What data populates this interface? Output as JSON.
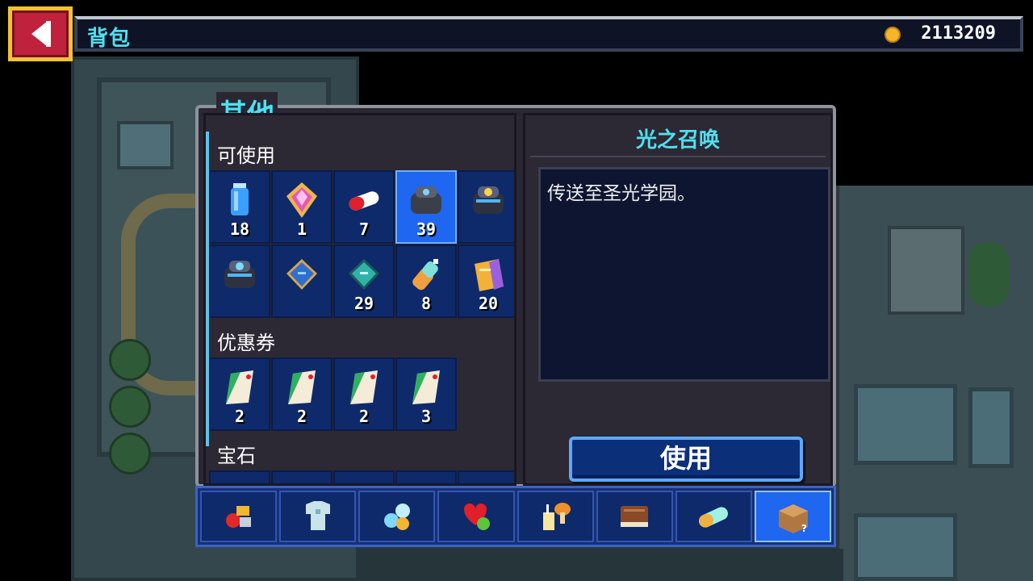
{
  "header": {
    "title": "背包",
    "gold": "2113209",
    "back_icon": "back-arrow-icon",
    "coin_icon": "gold-coin-icon"
  },
  "panel": {
    "category_title": "其他"
  },
  "sections": [
    {
      "label": "可使用",
      "items": [
        {
          "icon": "blue-potion-icon",
          "count": "18"
        },
        {
          "icon": "pink-crystal-icon",
          "count": "1"
        },
        {
          "icon": "red-capsule-icon",
          "count": "7"
        },
        {
          "icon": "dark-portal-device-icon",
          "count": "39",
          "selected": true
        },
        {
          "icon": "gold-portal-device-icon",
          "count": ""
        },
        {
          "icon": "blue-portal-device-icon",
          "count": ""
        },
        {
          "icon": "blue-book-icon",
          "count": ""
        },
        {
          "icon": "teal-book-icon",
          "count": "29"
        },
        {
          "icon": "spray-bottle-icon",
          "count": "8"
        },
        {
          "icon": "gold-ticket-icon",
          "count": "20"
        }
      ]
    },
    {
      "label": "优惠券",
      "items": [
        {
          "icon": "coupon-icon",
          "count": "2"
        },
        {
          "icon": "coupon-icon",
          "count": "2"
        },
        {
          "icon": "coupon-icon",
          "count": "2"
        },
        {
          "icon": "coupon-icon",
          "count": "3"
        }
      ]
    },
    {
      "label": "宝石",
      "items": []
    }
  ],
  "detail": {
    "name": "光之召唤",
    "description": "传送至圣光学园。",
    "use_label": "使用"
  },
  "tabs": [
    {
      "icon": "fruit-materials-icon",
      "active": false
    },
    {
      "icon": "armor-icon",
      "active": false
    },
    {
      "icon": "gems-icon",
      "active": false
    },
    {
      "icon": "heart-apple-icon",
      "active": false
    },
    {
      "icon": "drink-mushroom-icon",
      "active": false
    },
    {
      "icon": "book-icon",
      "active": false
    },
    {
      "icon": "capsule-icon",
      "active": false
    },
    {
      "icon": "mystery-box-icon",
      "active": true
    }
  ],
  "colors": {
    "accent_cyan": "#4fe0f0",
    "slot_blue": "#0e2a6b",
    "selected_blue": "#1f66f0",
    "back_red": "#c0213d",
    "frame_gold": "#f2c231"
  }
}
